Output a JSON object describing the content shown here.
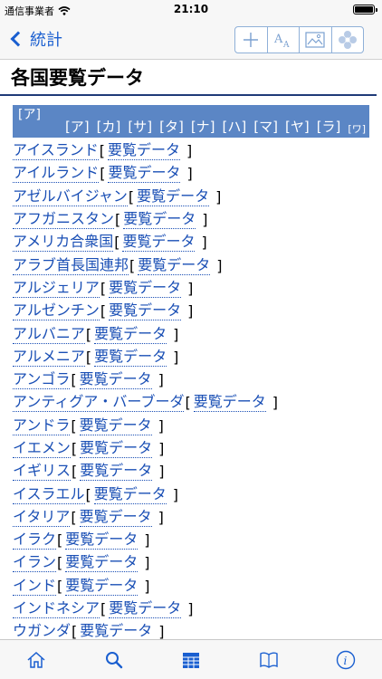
{
  "status": {
    "carrier": "通信事業者",
    "time": "21:10"
  },
  "nav": {
    "back_label": "統計"
  },
  "page": {
    "title": "各国要覧データ"
  },
  "index": {
    "current": "[ア]",
    "letters": [
      "[ア]",
      "[カ]",
      "[サ]",
      "[タ]",
      "[ナ]",
      "[ハ]",
      "[マ]",
      "[ヤ]",
      "[ラ]",
      "[ワ]"
    ]
  },
  "list": {
    "link_label": "要覧データ",
    "bracket_open": "[",
    "bracket_close": "]",
    "countries": [
      "アイスランド",
      "アイルランド",
      "アゼルバイジャン",
      "アフガニスタン",
      "アメリカ合衆国",
      "アラブ首長国連邦",
      "アルジェリア",
      "アルゼンチン",
      "アルバニア",
      "アルメニア",
      "アンゴラ",
      "アンティグア・バーブーダ",
      "アンドラ",
      "イエメン",
      "イギリス",
      "イスラエル",
      "イタリア",
      "イラク",
      "イラン",
      "インド",
      "インドネシア",
      "ウガンダ"
    ]
  },
  "colors": {
    "accent": "#1a5fd0",
    "index_bar": "#5b86c5",
    "link": "#1a4fb5",
    "rule": "#1f3b78"
  },
  "tabs": [
    "home-icon",
    "search-icon",
    "calendar-grid-icon",
    "book-icon",
    "info-icon"
  ]
}
